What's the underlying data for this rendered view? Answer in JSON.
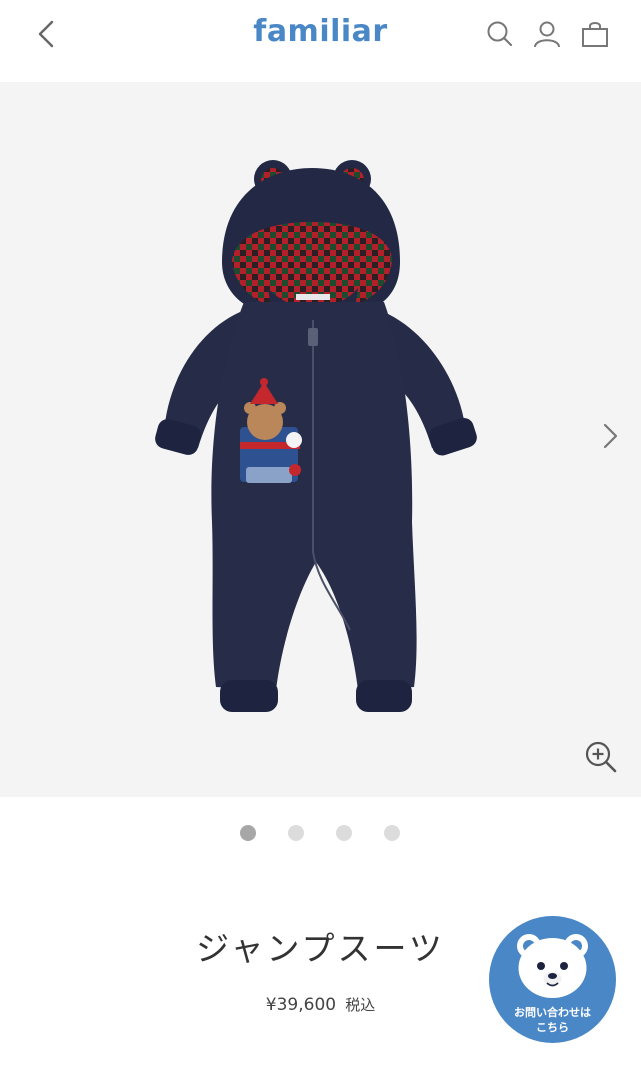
{
  "header": {
    "logo": "familiar",
    "back_icon": "chevron-left-icon",
    "search_icon": "search-icon",
    "account_icon": "user-icon",
    "cart_icon": "shopping-bag-icon"
  },
  "gallery": {
    "image_alt": "ジャンプスーツ",
    "next_icon": "chevron-right-icon",
    "zoom_icon": "zoom-in-icon",
    "slides": 4,
    "active_slide": 1
  },
  "product": {
    "name": "ジャンプスーツ",
    "price": "¥39,600",
    "tax_label": "税込"
  },
  "contact": {
    "line1": "お問い合わせは",
    "line2": "こちら",
    "icon": "bear-face-icon"
  },
  "colors": {
    "brand": "#4a87c6",
    "gallery_bg": "#f4f4f4",
    "dot_active": "#a7a7a7",
    "dot_inactive": "#dcdcdc"
  }
}
